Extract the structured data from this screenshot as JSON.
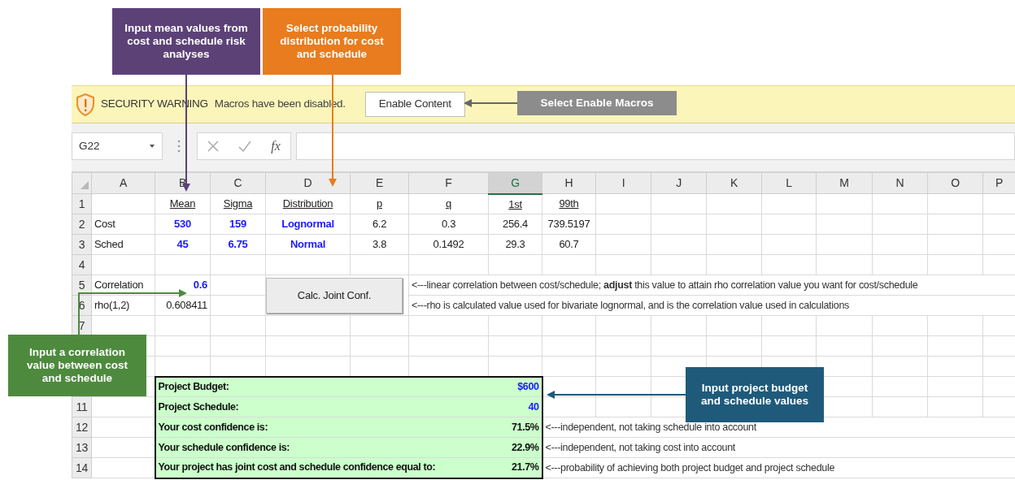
{
  "callouts": [
    {
      "text": "Input mean values from cost and schedule risk analyses",
      "color": "#5c4177"
    },
    {
      "text": "Select probability distribution for cost and schedule",
      "color": "#e87c1e"
    },
    {
      "text": "Select Enable Macros",
      "color": "#8c8c8c"
    },
    {
      "text": "Input a correlation value between cost and schedule",
      "color": "#4e8a3e"
    },
    {
      "text": "Input project budget and schedule values",
      "color": "#1f5a7a"
    }
  ],
  "security_bar": {
    "title": "SECURITY WARNING",
    "message": "Macros have been disabled.",
    "button": "Enable Content"
  },
  "formula_bar": {
    "name_box": "G22",
    "function_button": "fx"
  },
  "columns": [
    {
      "label": "A",
      "selected": false
    },
    {
      "label": "B",
      "selected": false
    },
    {
      "label": "C",
      "selected": false
    },
    {
      "label": "D",
      "selected": false
    },
    {
      "label": "E",
      "selected": false
    },
    {
      "label": "F",
      "selected": false
    },
    {
      "label": "G",
      "selected": true
    },
    {
      "label": "H",
      "selected": false
    },
    {
      "label": "I",
      "selected": false
    },
    {
      "label": "J",
      "selected": false
    },
    {
      "label": "K",
      "selected": false
    },
    {
      "label": "L",
      "selected": false
    },
    {
      "label": "M",
      "selected": false
    },
    {
      "label": "N",
      "selected": false
    },
    {
      "label": "O",
      "selected": false
    },
    {
      "label": "P",
      "selected": false
    }
  ],
  "row_numbers": [
    "1",
    "2",
    "3",
    "4",
    "5",
    "6",
    "7",
    "11",
    "12",
    "13",
    "14"
  ],
  "parameters": {
    "headers": [
      "Mean",
      "Sigma",
      "Distribution",
      "p",
      "q",
      "1st",
      "99th"
    ],
    "items": [
      {
        "name": "Cost",
        "mean": "530",
        "sigma": "159",
        "distribution": "Lognormal",
        "p": "6.2",
        "q": "0.3",
        "first": "256.4",
        "ninety_ninth": "739.5197"
      },
      {
        "name": "Sched",
        "mean": "45",
        "sigma": "6.75",
        "distribution": "Normal",
        "p": "3.8",
        "q": "0.1492",
        "first": "29.3",
        "ninety_ninth": "60.7"
      }
    ]
  },
  "correlation": {
    "label": "Correlation",
    "value": "0.6",
    "note": "<---linear correlation between cost/schedule; **adjust** this value to attain rho correlation value you want for cost/schedule"
  },
  "rho": {
    "label": "rho(1,2)",
    "value": "0.608411",
    "note": "<---rho is calculated value used for bivariate lognormal, and is the correlation value used in calculations"
  },
  "calc_button": "Calc. Joint Conf.",
  "results": [
    {
      "label": "Project Budget:",
      "value": "$600",
      "color": "#1a1aff"
    },
    {
      "label": "Project Schedule:",
      "value": "40",
      "color": "#1a1aff"
    },
    {
      "label": "Your cost confidence is:",
      "value": "71.5%",
      "color": "#111111",
      "note": "<---independent, not taking schedule into account"
    },
    {
      "label": "Your schedule confidence is:",
      "value": "22.9%",
      "color": "#111111",
      "note": "<---independent, not taking cost into account"
    },
    {
      "label": "Your project has joint cost and schedule confidence equal to:",
      "value": "21.7%",
      "color": "#111111",
      "note": "<---probability of achieving both project budget and project schedule"
    }
  ]
}
